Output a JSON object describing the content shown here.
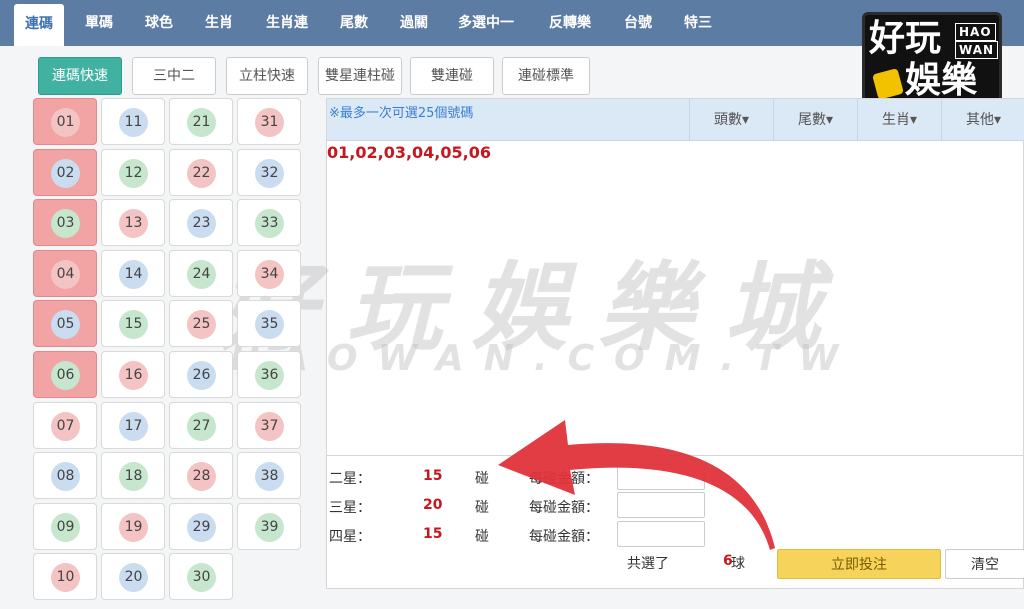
{
  "nav": {
    "items": [
      {
        "label": "連碼",
        "active": true
      },
      {
        "label": "單碼"
      },
      {
        "label": "球色"
      },
      {
        "label": "生肖"
      },
      {
        "label": "生肖連"
      },
      {
        "label": "尾數"
      },
      {
        "label": "過關"
      },
      {
        "label": "多選中一"
      },
      {
        "label": "反轉樂"
      },
      {
        "label": "台號"
      },
      {
        "label": "特三"
      }
    ]
  },
  "logo": {
    "cn_1": "好玩",
    "cn_2": "娛樂",
    "en_1": "HAO",
    "en_2": "WAN"
  },
  "modes": [
    {
      "label": "連碼快速",
      "active": true
    },
    {
      "label": "三中二"
    },
    {
      "label": "立柱快速"
    },
    {
      "label": "雙星連柱碰"
    },
    {
      "label": "雙連碰"
    },
    {
      "label": "連碰標準"
    }
  ],
  "numbers": [
    {
      "n": "01",
      "color": "red",
      "selected": true
    },
    {
      "n": "02",
      "color": "blue",
      "selected": true
    },
    {
      "n": "03",
      "color": "green",
      "selected": true
    },
    {
      "n": "04",
      "color": "red",
      "selected": true
    },
    {
      "n": "05",
      "color": "blue",
      "selected": true
    },
    {
      "n": "06",
      "color": "green",
      "selected": true
    },
    {
      "n": "07",
      "color": "red"
    },
    {
      "n": "08",
      "color": "blue"
    },
    {
      "n": "09",
      "color": "green"
    },
    {
      "n": "10",
      "color": "red"
    },
    {
      "n": "11",
      "color": "blue"
    },
    {
      "n": "12",
      "color": "green"
    },
    {
      "n": "13",
      "color": "red"
    },
    {
      "n": "14",
      "color": "blue"
    },
    {
      "n": "15",
      "color": "green"
    },
    {
      "n": "16",
      "color": "red"
    },
    {
      "n": "17",
      "color": "blue"
    },
    {
      "n": "18",
      "color": "green"
    },
    {
      "n": "19",
      "color": "red"
    },
    {
      "n": "20",
      "color": "blue"
    },
    {
      "n": "21",
      "color": "green"
    },
    {
      "n": "22",
      "color": "red"
    },
    {
      "n": "23",
      "color": "blue"
    },
    {
      "n": "24",
      "color": "green"
    },
    {
      "n": "25",
      "color": "red"
    },
    {
      "n": "26",
      "color": "blue"
    },
    {
      "n": "27",
      "color": "green"
    },
    {
      "n": "28",
      "color": "red"
    },
    {
      "n": "29",
      "color": "blue"
    },
    {
      "n": "30",
      "color": "green"
    },
    {
      "n": "31",
      "color": "red"
    },
    {
      "n": "32",
      "color": "blue"
    },
    {
      "n": "33",
      "color": "green"
    },
    {
      "n": "34",
      "color": "red"
    },
    {
      "n": "35",
      "color": "blue"
    },
    {
      "n": "36",
      "color": "green"
    },
    {
      "n": "37",
      "color": "red"
    },
    {
      "n": "38",
      "color": "blue"
    },
    {
      "n": "39",
      "color": "green"
    }
  ],
  "selection": {
    "note": "※最多一次可選25個號碼",
    "selected_numbers": "01,02,03,04,05,06",
    "filters": [
      "頭數▾",
      "尾數▾",
      "生肖▾",
      "其他▾"
    ]
  },
  "bets": [
    {
      "label": "二星：",
      "count": "15",
      "unit": "碰",
      "amount_label": "每碰金額：",
      "amount": ""
    },
    {
      "label": "三星：",
      "count": "20",
      "unit": "碰",
      "amount_label": "每碰金額：",
      "amount": ""
    },
    {
      "label": "四星：",
      "count": "15",
      "unit": "碰",
      "amount_label": "每碰金額：",
      "amount": ""
    }
  ],
  "summary": {
    "total_label": "共選了",
    "total_count": "6",
    "total_unit": "球",
    "bet_label": "立即投注",
    "clear_label": "清空"
  },
  "watermark": {
    "cn": "好玩娛樂城",
    "en": "HAOWAN.COM.TW"
  },
  "colors": {
    "nav_bg": "#5d7ca3",
    "mode_active": "#41b2a1",
    "selected_cell": "#f2a3a3",
    "bet_button": "#f6d35a",
    "accent_red": "#c8161e"
  }
}
